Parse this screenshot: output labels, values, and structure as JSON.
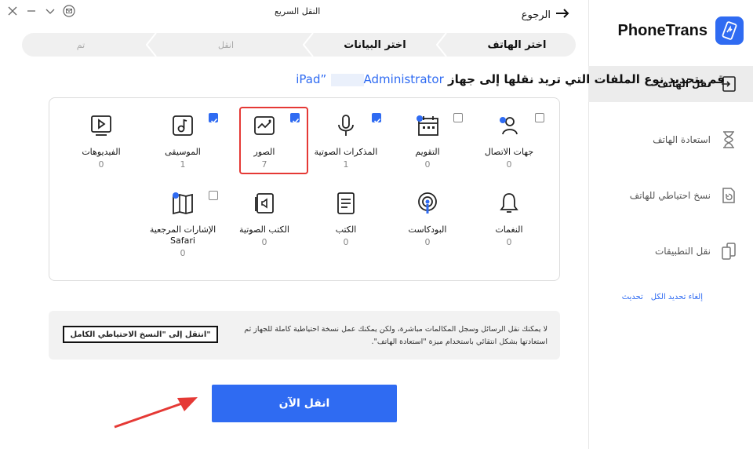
{
  "window": {
    "title": "النقل السريع",
    "back_label": "الرجوع"
  },
  "brand": {
    "name": "PhoneTrans"
  },
  "sidebar": {
    "items": [
      {
        "label": "نقل الهاتف",
        "icon": "phone-transfer-icon",
        "active": true
      },
      {
        "label": "استعادة الهاتف",
        "icon": "hourglass-icon",
        "active": false
      },
      {
        "label": "نسخ احتياطي للهاتف",
        "icon": "backup-icon",
        "active": false
      },
      {
        "label": "نقل التطبيقات",
        "icon": "apps-transfer-icon",
        "active": false
      }
    ]
  },
  "steps": [
    {
      "label": "اختر الهاتف",
      "state": "done"
    },
    {
      "label": "اختر البيانات",
      "state": "current"
    },
    {
      "label": "انقل",
      "state": "todo"
    },
    {
      "label": "تم",
      "state": "todo"
    }
  ],
  "heading": {
    "text": "قم بتحديد نوع الملفات التي تريد نقلها إلى جهاز",
    "device": "Administrator",
    "device_suffix": "iPad”"
  },
  "categories": [
    {
      "label": "جهات الاتصال",
      "count": "0",
      "icon": "contacts-icon",
      "checked": false
    },
    {
      "label": "التقويم",
      "count": "0",
      "icon": "calendar-icon",
      "checked": false
    },
    {
      "label": "المذكرات الصوتية",
      "count": "1",
      "icon": "microphone-icon",
      "checked": true
    },
    {
      "label": "الصور",
      "count": "7",
      "icon": "photo-icon",
      "checked": true
    },
    {
      "label": "الموسيقى",
      "count": "1",
      "icon": "music-icon",
      "checked": true
    },
    {
      "label": "الفيديوهات",
      "count": "0",
      "icon": "video-icon",
      "checked": false
    },
    {
      "label": "النغمات",
      "count": "0",
      "icon": "bell-icon",
      "checked": false
    },
    {
      "label": "البودكاست",
      "count": "0",
      "icon": "podcast-icon",
      "checked": false
    },
    {
      "label": "الكتب",
      "count": "0",
      "icon": "book-icon",
      "checked": false
    },
    {
      "label": "الكتب الصوتية",
      "count": "0",
      "icon": "audiobook-icon",
      "checked": false
    },
    {
      "label": "الإشارات المرجعية Safari",
      "count": "0",
      "icon": "bookmark-icon",
      "checked": false
    }
  ],
  "links": {
    "deselect_all": "إلغاء تحديد الكل",
    "refresh": "تحديث"
  },
  "notice": {
    "text": "لا يمكنك نقل الرسائل وسجل المكالمات مباشرة، ولكن يمكنك عمل نسخة احتياطية كاملة للجهاز ثم استعادتها بشكل انتقائي باستخدام ميزة \"استعادة الهاتف\".",
    "button": "انتقل إلى \"النسخ الاحتياطي الكامل\""
  },
  "transfer_button": "انقل الآن",
  "colors": {
    "accent": "#2f6bf2",
    "highlight": "#e53935"
  }
}
